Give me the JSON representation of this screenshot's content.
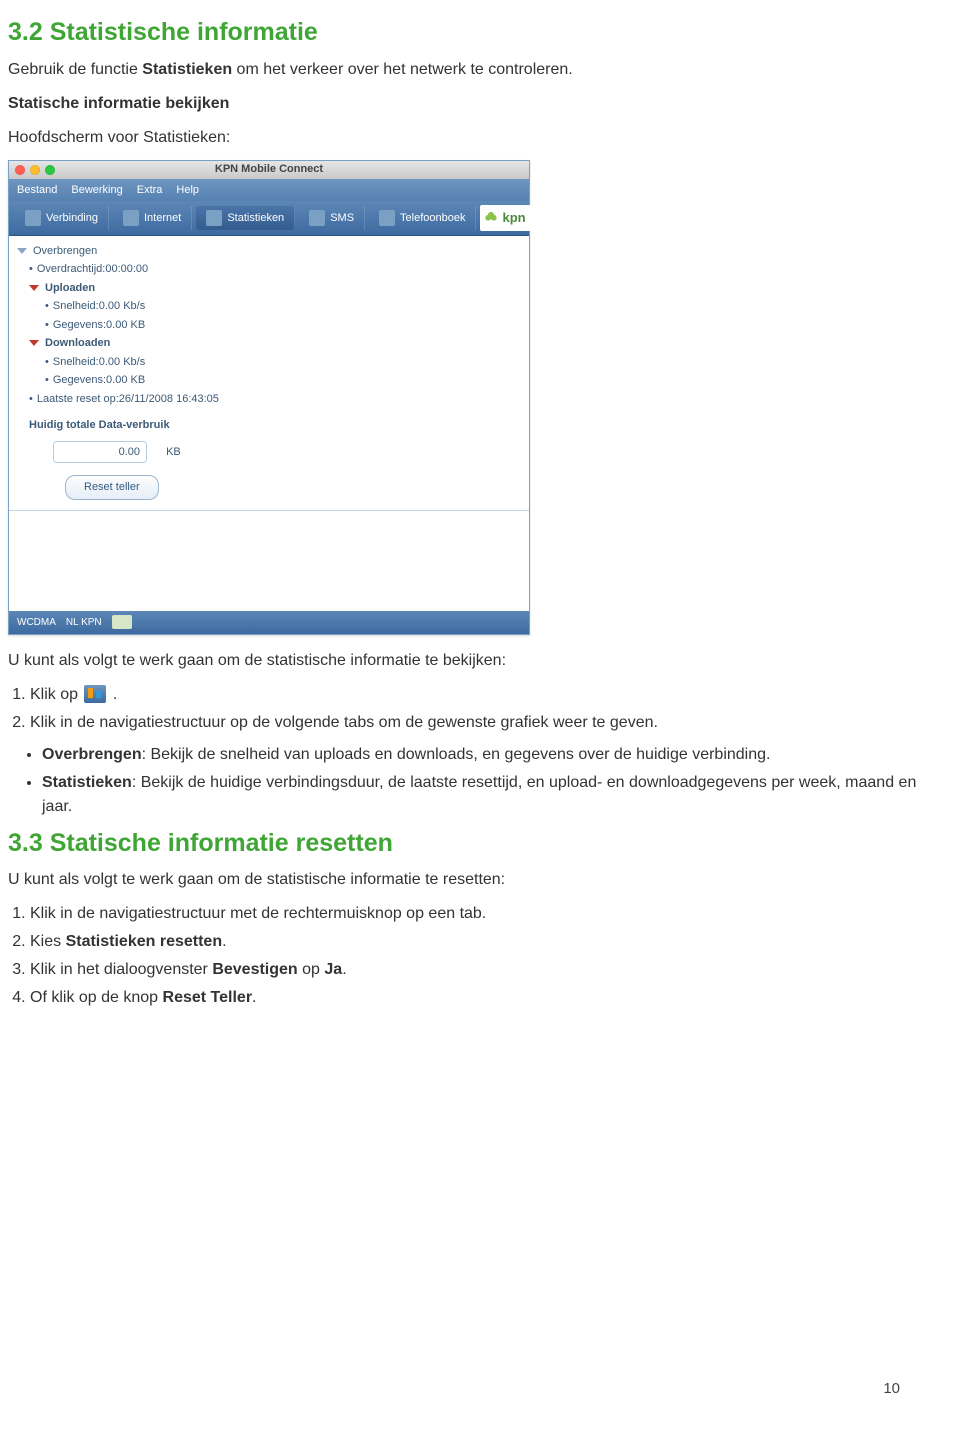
{
  "section_32": {
    "title": "3.2 Statistische informatie",
    "intro_pre": "Gebruik de functie ",
    "intro_bold": "Statistieken",
    "intro_post": " om het verkeer over het netwerk te controleren.",
    "sub_bold": "Statische informatie bekijken",
    "sub_text": "Hoofdscherm voor Statistieken:",
    "after_shot": "U kunt als volgt te werk gaan om de statistische informatie te bekijken:",
    "li1_pre": "Klik op ",
    "li1_post": " .",
    "li2": "Klik in de navigatiestructuur op de volgende tabs om de gewenste grafiek weer te geven.",
    "b1_bold": "Overbrengen",
    "b1_rest": ": Bekijk de snelheid van uploads en downloads, en gegevens over de huidige verbinding.",
    "b2_bold": "Statistieken",
    "b2_rest": ": Bekijk de huidige verbindingsduur, de laatste resettijd, en upload- en downloadgegevens per week, maand en jaar."
  },
  "section_33": {
    "title": "3.3 Statische informatie resetten",
    "intro": "U kunt als volgt te werk gaan om de statistische informatie te resetten:",
    "li1": "Klik in de navigatiestructuur met de rechtermuisknop op een tab.",
    "li2_pre": "Kies ",
    "li2_bold": "Statistieken resetten",
    "li2_post": ".",
    "li3_pre": "Klik in het dialoogvenster ",
    "li3_bold1": "Bevestigen",
    "li3_mid": " op ",
    "li3_bold2": "Ja",
    "li3_post": ".",
    "li4_pre": "Of klik op de knop ",
    "li4_bold": "Reset Teller",
    "li4_post": "."
  },
  "screenshot": {
    "title": "KPN Mobile Connect",
    "menus": [
      "Bestand",
      "Bewerking",
      "Extra",
      "Help"
    ],
    "tabs": [
      "Verbinding",
      "Internet",
      "Statistieken",
      "SMS",
      "Telefoonboek"
    ],
    "kpn": "kpn",
    "tree": {
      "overbrengen": "Overbrengen",
      "overdrachtijd": "Overdrachtijd:00:00:00",
      "uploaden": "Uploaden",
      "up_snelheid": "Snelheid:0.00 Kb/s",
      "up_gegevens": "Gegevens:0.00 KB",
      "downloaden": "Downloaden",
      "dn_snelheid": "Snelheid:0.00 Kb/s",
      "dn_gegevens": "Gegevens:0.00 KB",
      "laatste_reset": "Laatste reset op:26/11/2008 16:43:05",
      "total_label": "Huidig totale Data-verbruik",
      "total_value": "0.00",
      "total_unit": "KB",
      "reset_btn": "Reset teller"
    },
    "status": {
      "net": "WCDMA",
      "op": "NL KPN"
    }
  },
  "page_number": "10"
}
